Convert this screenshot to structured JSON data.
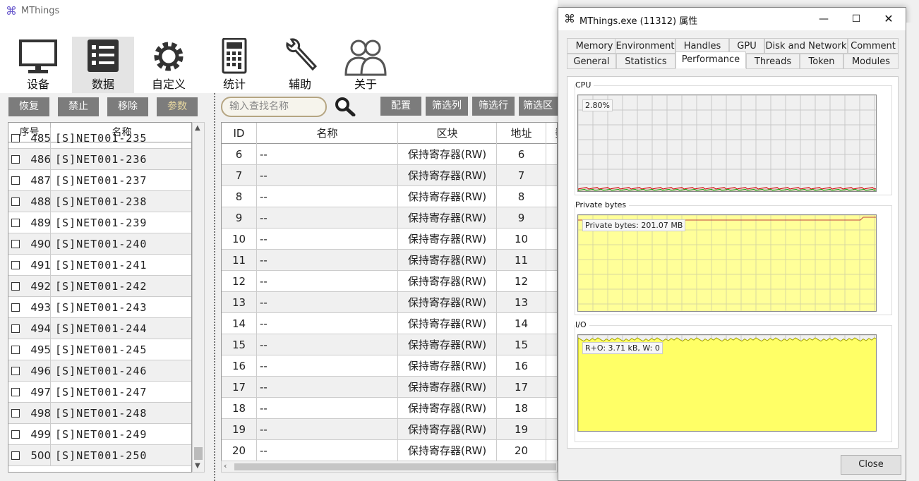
{
  "app": {
    "title": "MThings"
  },
  "toolbar": {
    "items": [
      {
        "label": "设备",
        "icon": "monitor-icon"
      },
      {
        "label": "数据",
        "icon": "data-list-icon"
      },
      {
        "label": "自定义",
        "icon": "gear-icon"
      },
      {
        "label": "统计",
        "icon": "calculator-icon"
      },
      {
        "label": "辅助",
        "icon": "wrench-icon"
      },
      {
        "label": "关于",
        "icon": "users-icon"
      }
    ],
    "active": "数据"
  },
  "left_panel": {
    "buttons": [
      "恢复",
      "禁止",
      "移除",
      "参数"
    ],
    "columns": [
      "序号",
      "名称"
    ],
    "rows": [
      {
        "num": "485",
        "name": "[S]NET001-235"
      },
      {
        "num": "486",
        "name": "[S]NET001-236"
      },
      {
        "num": "487",
        "name": "[S]NET001-237"
      },
      {
        "num": "488",
        "name": "[S]NET001-238"
      },
      {
        "num": "489",
        "name": "[S]NET001-239"
      },
      {
        "num": "490",
        "name": "[S]NET001-240"
      },
      {
        "num": "491",
        "name": "[S]NET001-241"
      },
      {
        "num": "492",
        "name": "[S]NET001-242"
      },
      {
        "num": "493",
        "name": "[S]NET001-243"
      },
      {
        "num": "494",
        "name": "[S]NET001-244"
      },
      {
        "num": "495",
        "name": "[S]NET001-245"
      },
      {
        "num": "496",
        "name": "[S]NET001-246"
      },
      {
        "num": "497",
        "name": "[S]NET001-247"
      },
      {
        "num": "498",
        "name": "[S]NET001-248"
      },
      {
        "num": "499",
        "name": "[S]NET001-249"
      },
      {
        "num": "500",
        "name": "[S]NET001-250"
      }
    ]
  },
  "search": {
    "placeholder": "输入查找名称"
  },
  "main_buttons": [
    "配置",
    "筛选列",
    "筛选行",
    "筛选区"
  ],
  "main_table": {
    "columns": [
      "ID",
      "名称",
      "区块",
      "地址",
      "数"
    ],
    "rows": [
      {
        "id": "6",
        "name": "--",
        "block": "保持寄存器(RW)",
        "addr": "6"
      },
      {
        "id": "7",
        "name": "--",
        "block": "保持寄存器(RW)",
        "addr": "7"
      },
      {
        "id": "8",
        "name": "--",
        "block": "保持寄存器(RW)",
        "addr": "8"
      },
      {
        "id": "9",
        "name": "--",
        "block": "保持寄存器(RW)",
        "addr": "9"
      },
      {
        "id": "10",
        "name": "--",
        "block": "保持寄存器(RW)",
        "addr": "10"
      },
      {
        "id": "11",
        "name": "--",
        "block": "保持寄存器(RW)",
        "addr": "11"
      },
      {
        "id": "12",
        "name": "--",
        "block": "保持寄存器(RW)",
        "addr": "12"
      },
      {
        "id": "13",
        "name": "--",
        "block": "保持寄存器(RW)",
        "addr": "13"
      },
      {
        "id": "14",
        "name": "--",
        "block": "保持寄存器(RW)",
        "addr": "14"
      },
      {
        "id": "15",
        "name": "--",
        "block": "保持寄存器(RW)",
        "addr": "15"
      },
      {
        "id": "16",
        "name": "--",
        "block": "保持寄存器(RW)",
        "addr": "16"
      },
      {
        "id": "17",
        "name": "--",
        "block": "保持寄存器(RW)",
        "addr": "17"
      },
      {
        "id": "18",
        "name": "--",
        "block": "保持寄存器(RW)",
        "addr": "18"
      },
      {
        "id": "19",
        "name": "--",
        "block": "保持寄存器(RW)",
        "addr": "19"
      },
      {
        "id": "20",
        "name": "--",
        "block": "保持寄存器(RW)",
        "addr": "20"
      }
    ]
  },
  "dialog": {
    "title": "MThings.exe (11312) 属性",
    "tabs_row1": [
      "Memory",
      "Environment",
      "Handles",
      "GPU",
      "Disk and Network",
      "Comment"
    ],
    "tabs_row2": [
      "General",
      "Statistics",
      "Performance",
      "Threads",
      "Token",
      "Modules"
    ],
    "active_tab": "Performance",
    "cpu": {
      "label": "CPU",
      "value": "2.80%"
    },
    "private_bytes": {
      "label": "Private bytes",
      "value": "Private bytes: 201.07 MB"
    },
    "io": {
      "label": "I/O",
      "value": "R+O: 3.71 kB, W: 0"
    },
    "close_label": "Close"
  },
  "colors": {
    "button_gray": "#7c7c7c",
    "graph_grid": "#c8c8c8",
    "mem_fill": "#ffff99",
    "io_fill": "#ffff66"
  }
}
